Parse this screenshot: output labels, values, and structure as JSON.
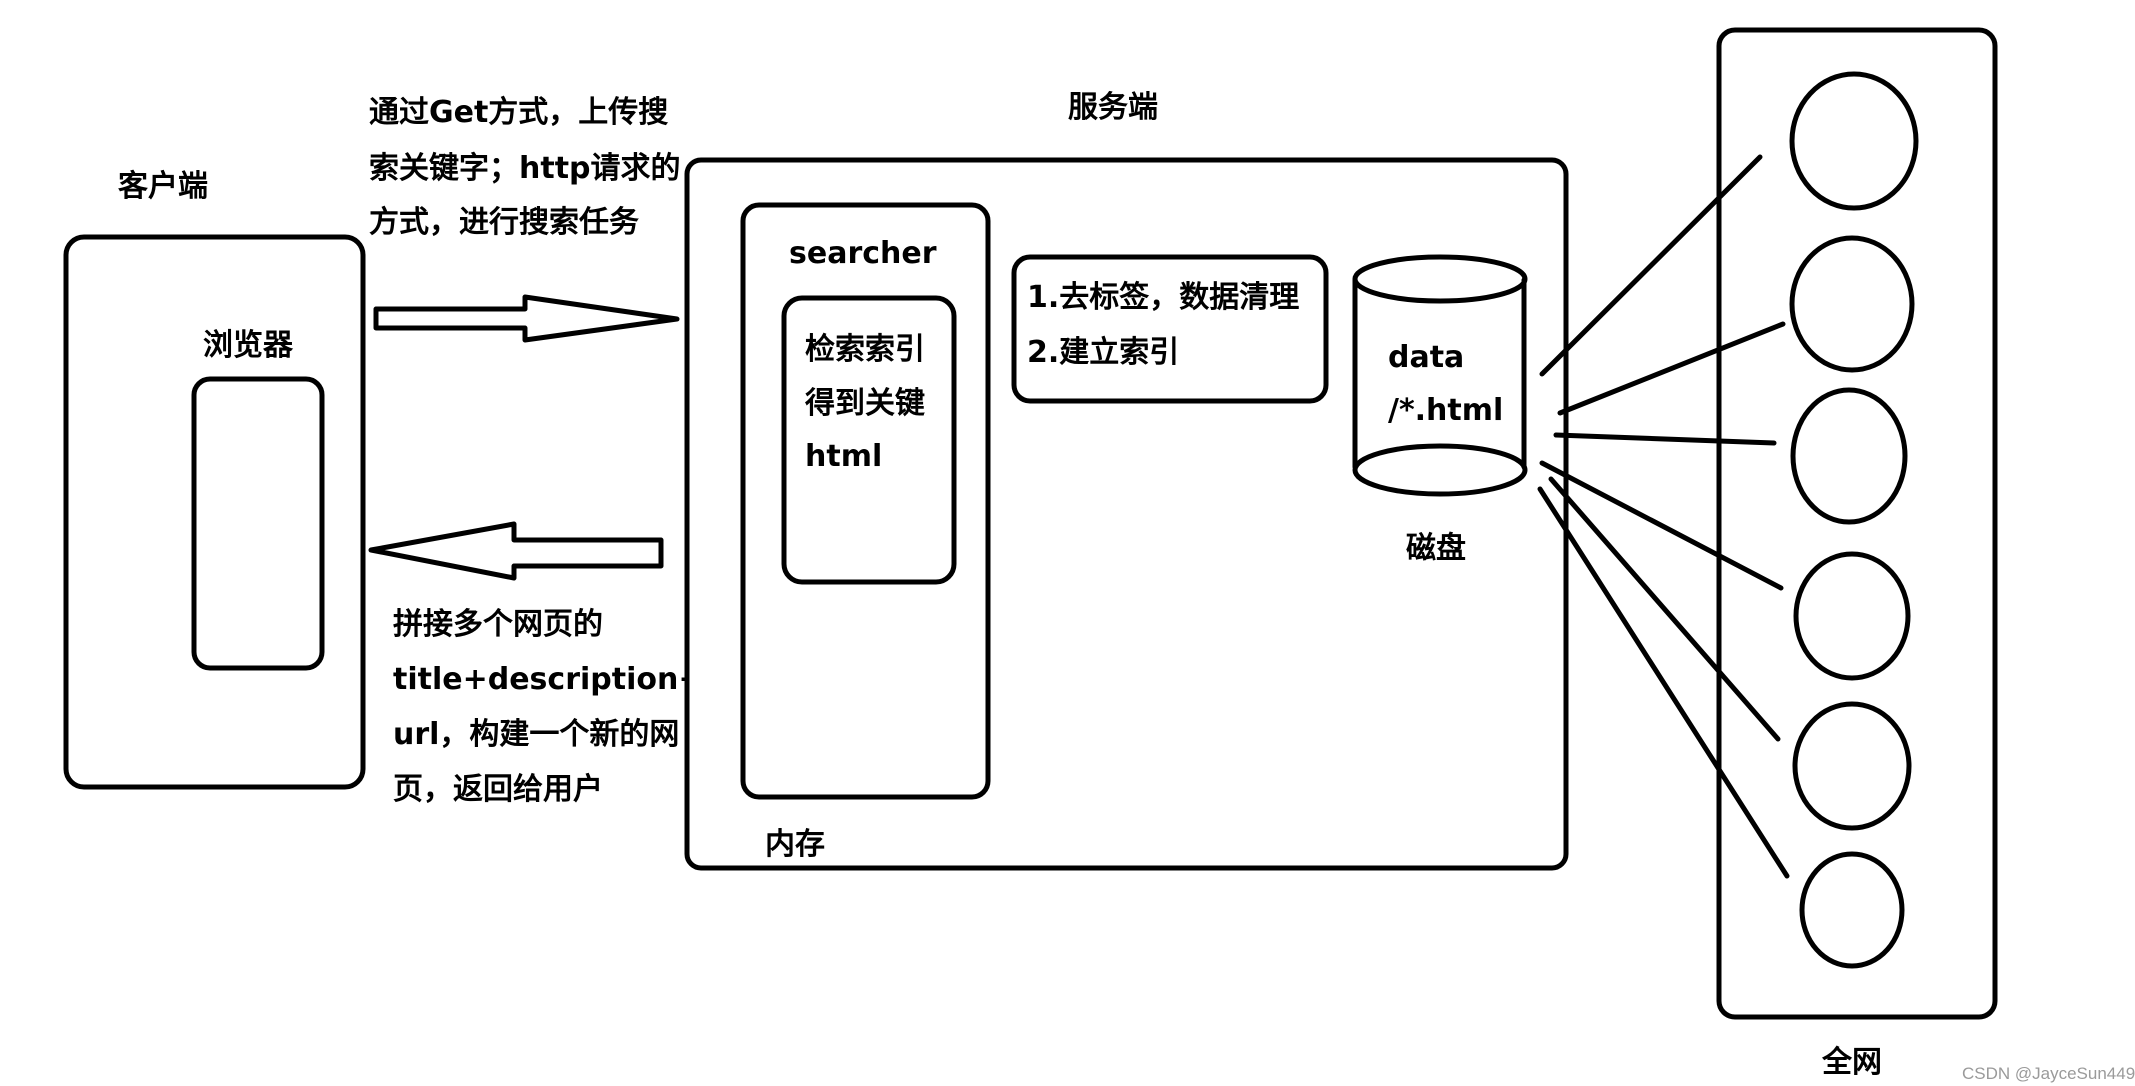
{
  "client": {
    "label": "客户端",
    "browser_label": "浏览器"
  },
  "request": {
    "lines": [
      "通过Get方式，上传搜",
      "索关键字；http请求的",
      "方式，进行搜索任务"
    ]
  },
  "response": {
    "lines": [
      "拼接多个网页的",
      "title+description+",
      "url，构建一个新的网",
      "页，返回给用户"
    ]
  },
  "server": {
    "label": "服务端",
    "memory_label": "内存",
    "searcher": {
      "title": "searcher",
      "inner_lines": [
        "检索索引",
        "得到关键",
        "html"
      ]
    },
    "process": {
      "lines": [
        "1.去标签，数据清理",
        "2.建立索引"
      ]
    },
    "disk": {
      "lines": [
        "data",
        "/*.html"
      ],
      "label": "磁盘"
    }
  },
  "web": {
    "label": "全网",
    "node_count": 6
  },
  "watermark": "CSDN @JayceSun449"
}
